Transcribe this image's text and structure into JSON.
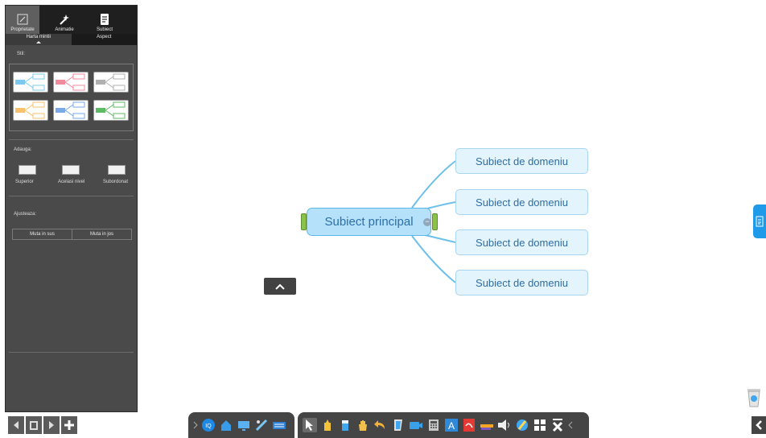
{
  "panel": {
    "tabs": [
      {
        "label": "Proprietate",
        "icon": "pencil-square-icon"
      },
      {
        "label": "Animatie",
        "icon": "magic-wand-icon"
      },
      {
        "label": "Subiect",
        "icon": "document-icon"
      }
    ],
    "subtabs": [
      "Harta mintii",
      "Aspect"
    ],
    "style_label": "Stil:",
    "add_label": "Adauga:",
    "add_buttons": [
      "Superior",
      "Acelasi nivel",
      "Subordonat"
    ],
    "adjust_label": "Ajusteaza:",
    "move_buttons": [
      "Muta in sus",
      "Muta in jos"
    ],
    "style_colors": [
      "#7cc9ef",
      "#f08a9c",
      "#b0b0b0",
      "#f7c26b",
      "#7aa9e8",
      "#5dbb63"
    ]
  },
  "mindmap": {
    "central": "Subiect principal",
    "topics": [
      "Subiect de domeniu",
      "Subiect de domeniu",
      "Subiect de domeniu",
      "Subiect de domeniu"
    ],
    "line_color": "#6cc0ea"
  },
  "colors": {
    "panel_bg": "#4a4a4a",
    "accent_blue": "#1e9ae8"
  }
}
